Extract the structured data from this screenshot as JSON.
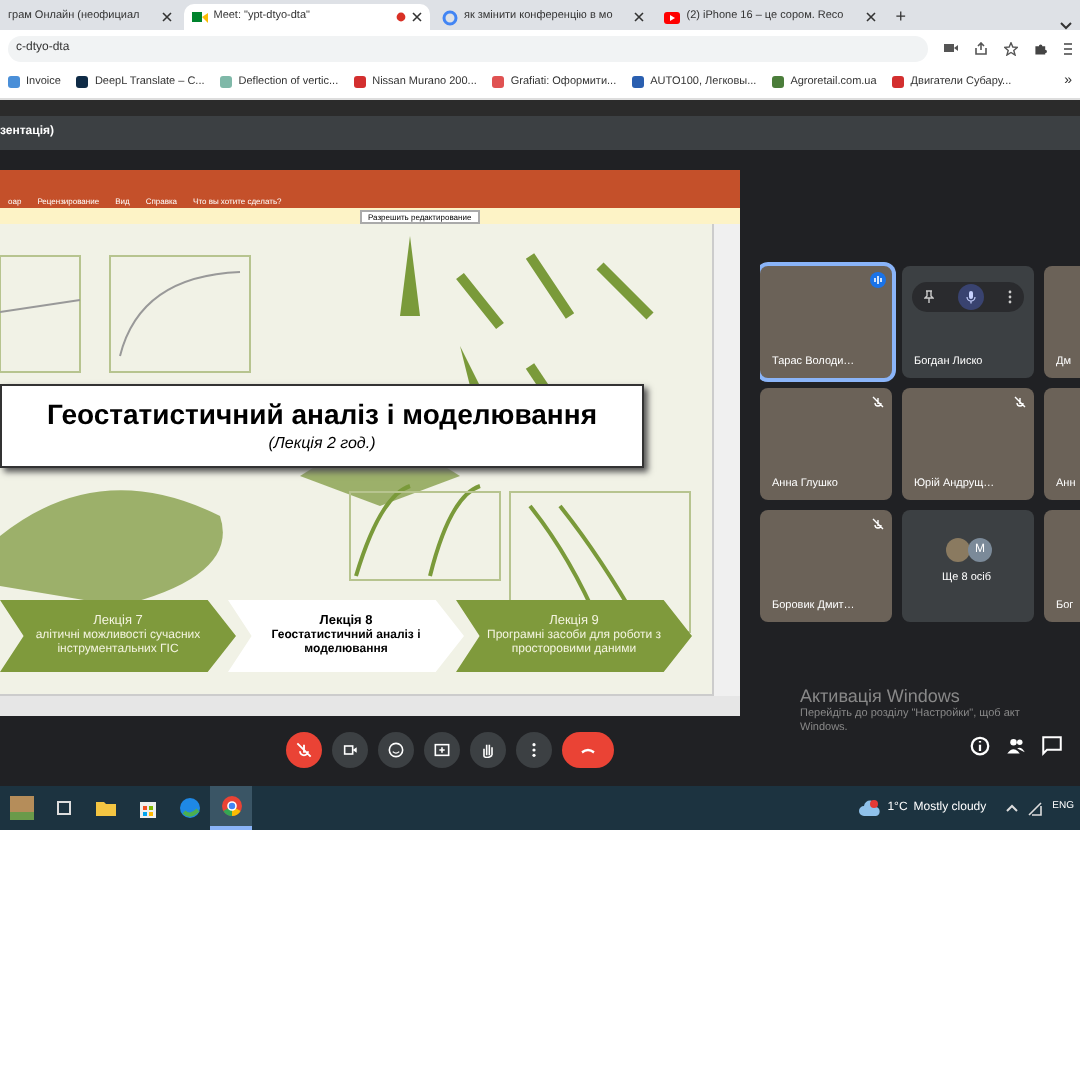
{
  "browser_tabs": [
    {
      "title": "грам Онлайн (неофициал",
      "kind": "plain",
      "selected": false
    },
    {
      "title": "Meet: \"ypt-dtyo-dta\"",
      "kind": "meet",
      "selected": true
    },
    {
      "title": "як змінити конференцію в мо",
      "kind": "google",
      "selected": false
    },
    {
      "title": "(2) iPhone 16 – це сором. Reco",
      "kind": "youtube",
      "selected": false
    }
  ],
  "new_tab": "+",
  "address_bar": {
    "url": "c-dtyo-dta"
  },
  "bookmarks": [
    {
      "label": "Invoice",
      "color": "#4a8fd8"
    },
    {
      "label": "DeepL Translate – C...",
      "color": "#0f2b46"
    },
    {
      "label": "Deflection of vertic...",
      "color": "#7fb8a8"
    },
    {
      "label": "Nissan Murano 200...",
      "color": "#d32f2f"
    },
    {
      "label": "Grafiati: Оформити...",
      "color": "#e05252"
    },
    {
      "label": "AUTO100, Легковы...",
      "color": "#2a5fb0"
    },
    {
      "label": "Agroretail.com.ua",
      "color": "#4b7d3a"
    },
    {
      "label": "Двигатели Субару...",
      "color": "#d32f2f"
    }
  ],
  "bookmarks_more": "»",
  "meeting_title": "зентація)",
  "powerpoint": {
    "menu": [
      "оар",
      "Рецензирование",
      "Вид",
      "Справка",
      "Что вы хотите сделать?"
    ],
    "protected_button": "Разрешить редактирование"
  },
  "slide": {
    "title": "Геостатистичний аналіз і моделювання",
    "subtitle": "(Лекція 2 год.)",
    "lectures": [
      {
        "number": "Лекція 7",
        "topic": "алітичні можливості сучасних інструментальних ГІС",
        "selected": false
      },
      {
        "number": "Лекція 8",
        "topic": "Геостатистичний аналіз і моделювання",
        "selected": true
      },
      {
        "number": "Лекція 9",
        "topic": "Програмні засоби для роботи з просторовими даними",
        "selected": false
      }
    ]
  },
  "participants": [
    {
      "name": "Тарас Володи…",
      "kind": "video",
      "speaking": true,
      "muted": false
    },
    {
      "name": "Богдан Лиско",
      "kind": "hover",
      "speaking": false,
      "muted": false
    },
    {
      "name": "Дм",
      "kind": "video",
      "speaking": false,
      "muted": false
    },
    {
      "name": "Анна Глушко",
      "kind": "video",
      "speaking": false,
      "muted": true
    },
    {
      "name": "Юрій Андрущ…",
      "kind": "video",
      "speaking": false,
      "muted": true
    },
    {
      "name": "Анн",
      "kind": "video",
      "speaking": false,
      "muted": false
    },
    {
      "name": "Боровик Дмит…",
      "kind": "video",
      "speaking": false,
      "muted": true
    },
    {
      "name": "Ще 8 осіб",
      "kind": "more",
      "speaking": false,
      "muted": false,
      "avatar_letter": "M"
    },
    {
      "name": "Бог",
      "kind": "video",
      "speaking": false,
      "muted": false
    }
  ],
  "windows_activation": {
    "title": "Активація Windows",
    "text": "Перейдіть до розділу \"Настройки\", щоб акт",
    "text_2": "Windows."
  },
  "call_controls": [
    {
      "kind": "mic",
      "on": false
    },
    {
      "kind": "camera",
      "on": true
    },
    {
      "kind": "emoji",
      "on": true
    },
    {
      "kind": "present",
      "on": true
    },
    {
      "kind": "hand",
      "on": true
    },
    {
      "kind": "more",
      "on": true
    },
    {
      "kind": "end"
    }
  ],
  "side_controls": [
    {
      "kind": "info"
    },
    {
      "kind": "people"
    },
    {
      "kind": "chat"
    }
  ],
  "taskbar": {
    "apps": [
      {
        "kind": "photo",
        "selected": false
      },
      {
        "kind": "taskview",
        "selected": false
      },
      {
        "kind": "folder",
        "selected": false
      },
      {
        "kind": "store",
        "selected": false
      },
      {
        "kind": "edge",
        "selected": false
      },
      {
        "kind": "chrome",
        "selected": true
      }
    ],
    "temperature": "1°C",
    "weather": "Mostly cloudy",
    "language": "ENG"
  }
}
